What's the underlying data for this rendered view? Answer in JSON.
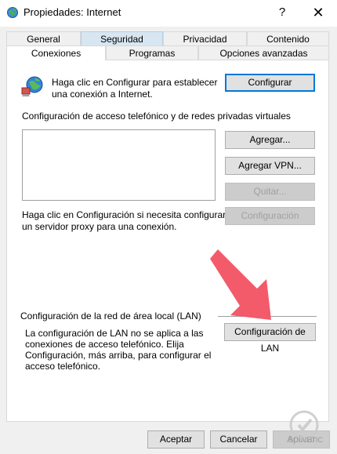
{
  "window": {
    "title": "Propiedades: Internet",
    "help_glyph": "?",
    "close_glyph": "✕"
  },
  "tabs_row1": [
    {
      "label": "General"
    },
    {
      "label": "Seguridad"
    },
    {
      "label": "Privacidad"
    },
    {
      "label": "Contenido"
    }
  ],
  "tabs_row2": [
    {
      "label": "Conexiones"
    },
    {
      "label": "Programas"
    },
    {
      "label": "Opciones avanzadas"
    }
  ],
  "setup": {
    "text_line1": "Haga clic en Configurar para establecer",
    "text_line2": "una conexión a Internet.",
    "button": "Configurar"
  },
  "dialup": {
    "heading": "Configuración de acceso telefónico y de redes privadas virtuales",
    "add_button": "Agregar...",
    "add_vpn_button": "Agregar VPN...",
    "remove_button": "Quitar...",
    "settings_button": "Configuración",
    "proxy_line1": "Haga clic en Configuración si necesita configurar",
    "proxy_line2": "un servidor proxy para una conexión."
  },
  "lan": {
    "heading": "Configuración de la red de área local (LAN)",
    "text_line1": "La configuración de LAN no se aplica a las",
    "text_line2": "conexiones de acceso telefónico. Elija",
    "text_line3": "Configuración, más arriba, para configurar el",
    "text_line4": "acceso telefónico.",
    "button": "Configuración de LAN"
  },
  "footer": {
    "ok": "Aceptar",
    "cancel": "Cancelar",
    "apply": "Aplicar"
  },
  "watermark": {
    "text": "SOLVETIC"
  },
  "colors": {
    "focus_border": "#0078d7",
    "arrow": "#f35a6a",
    "tab_hover": "#d8e6f2"
  },
  "icons": {
    "app": "internet-globe-icon",
    "setup": "globe-connect-icon",
    "annotation": "arrow-pointer-icon",
    "watermark": "solvetic-logo-icon"
  }
}
